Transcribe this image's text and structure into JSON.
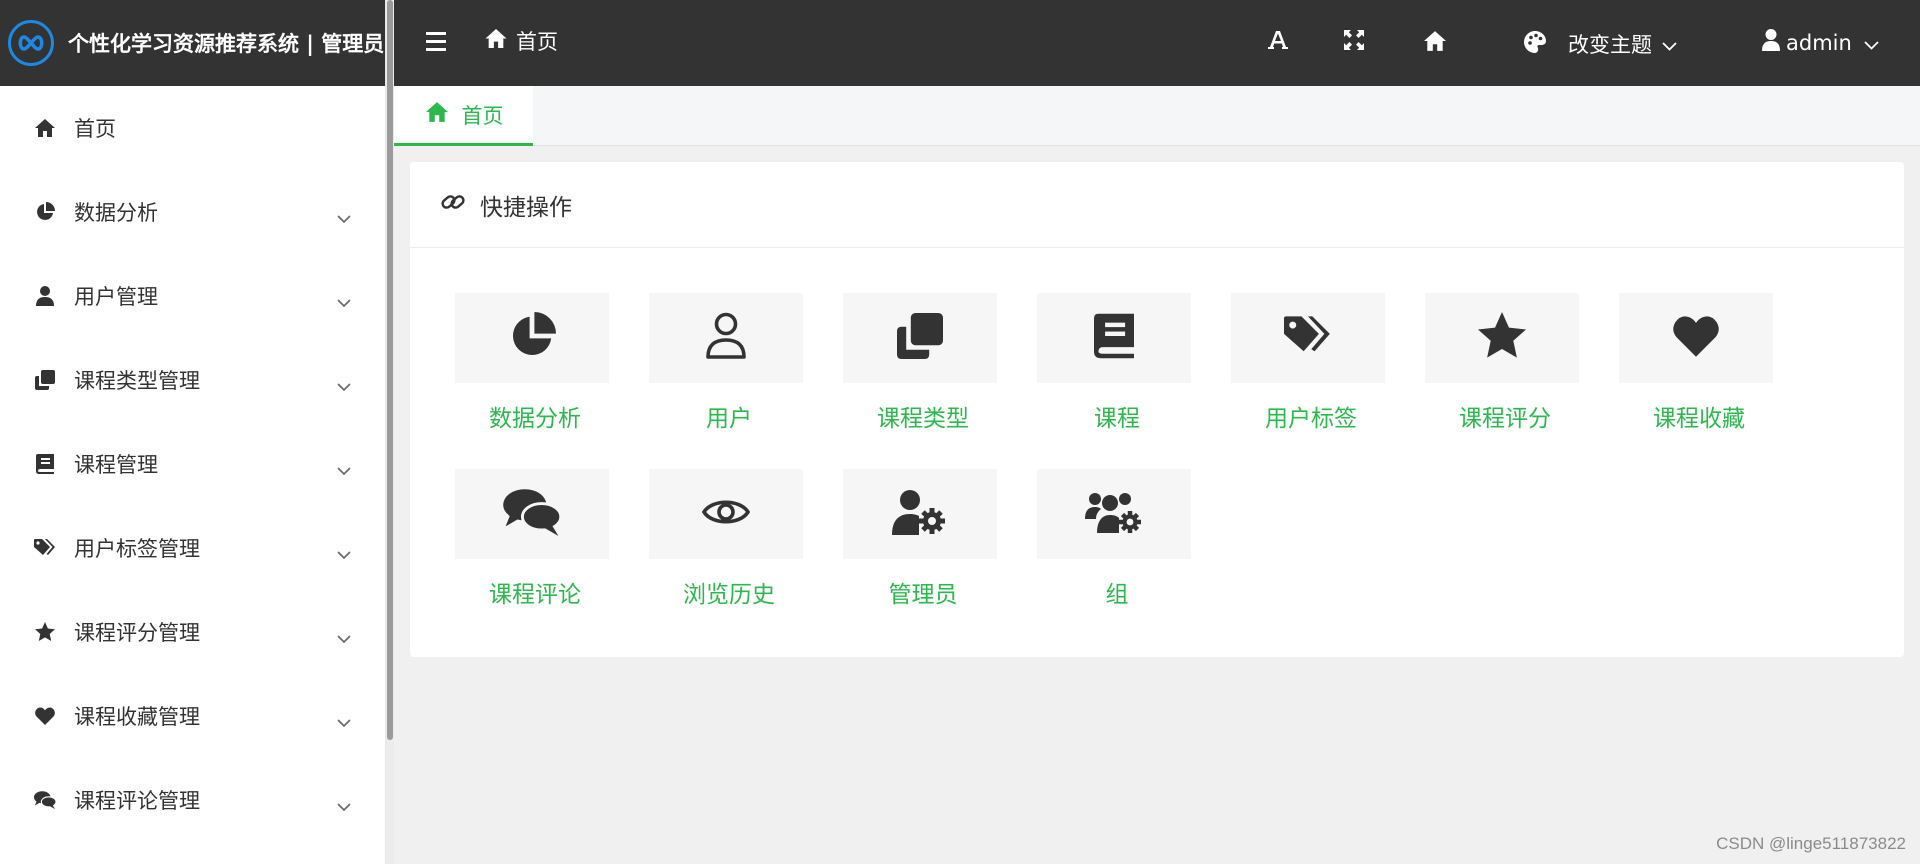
{
  "brand": {
    "title": "个性化学习资源推荐系统 | 管理员"
  },
  "sidebar": {
    "items": [
      {
        "label": "首页",
        "icon": "home-icon"
      },
      {
        "label": "数据分析",
        "icon": "pie-chart-icon"
      },
      {
        "label": "用户管理",
        "icon": "user-icon"
      },
      {
        "label": "课程类型管理",
        "icon": "copy-icon"
      },
      {
        "label": "课程管理",
        "icon": "book-icon"
      },
      {
        "label": "用户标签管理",
        "icon": "tags-icon"
      },
      {
        "label": "课程评分管理",
        "icon": "star-icon"
      },
      {
        "label": "课程收藏管理",
        "icon": "heart-icon"
      },
      {
        "label": "课程评论管理",
        "icon": "comments-icon"
      }
    ]
  },
  "header": {
    "breadcrumb": "首页",
    "theme_label": "改变主题",
    "user_label": "admin"
  },
  "tabs": [
    {
      "label": "首页",
      "active": true
    }
  ],
  "quick": {
    "title": "快捷操作",
    "tiles": [
      {
        "label": "数据分析",
        "icon": "pie-chart-icon"
      },
      {
        "label": "用户",
        "icon": "user-outline-icon"
      },
      {
        "label": "课程类型",
        "icon": "copy-icon"
      },
      {
        "label": "课程",
        "icon": "book-icon"
      },
      {
        "label": "用户标签",
        "icon": "tags-icon"
      },
      {
        "label": "课程评分",
        "icon": "star-icon"
      },
      {
        "label": "课程收藏",
        "icon": "heart-icon"
      },
      {
        "label": "课程评论",
        "icon": "comments-icon"
      },
      {
        "label": "浏览历史",
        "icon": "eye-icon"
      },
      {
        "label": "管理员",
        "icon": "user-cog-icon"
      },
      {
        "label": "组",
        "icon": "users-cog-icon"
      }
    ]
  },
  "watermark": "CSDN @linge511873822",
  "colors": {
    "accent": "#2db84d",
    "header_bg": "#333333",
    "logo": "#1e88e5"
  }
}
